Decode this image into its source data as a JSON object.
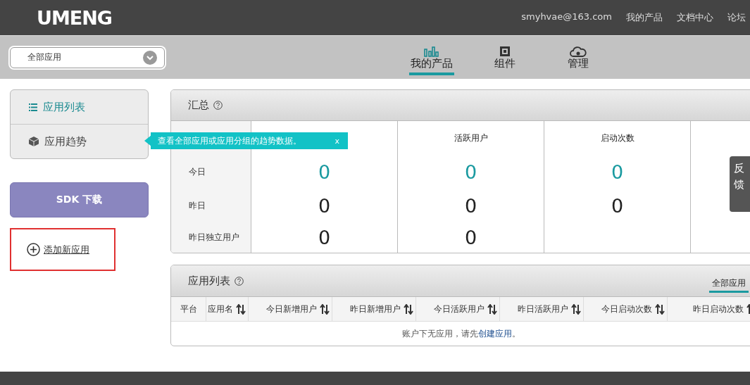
{
  "header": {
    "logo": "UMENG",
    "links": [
      "smyhvae@163.com",
      "我的产品",
      "文档中心",
      "论坛"
    ]
  },
  "subnav": {
    "app_select": "全部应用",
    "tabs": [
      {
        "label": "我的产品",
        "kind": "bars",
        "selected": true
      },
      {
        "label": "组件",
        "kind": "blocks",
        "selected": false
      },
      {
        "label": "管理",
        "kind": "cloud",
        "selected": false
      }
    ]
  },
  "sidebar": {
    "items": [
      {
        "label": "应用列表",
        "kind": "list",
        "selected": true
      },
      {
        "label": "应用趋势",
        "kind": "cube",
        "selected": false
      }
    ],
    "sdk_button": "SDK 下载",
    "add_app": "添加新应用"
  },
  "tooltip": {
    "text": "查看全部应用或应用分组的趋势数据。",
    "close": "x"
  },
  "summary": {
    "title": "汇总",
    "columns": [
      "",
      "活跃用户",
      "启动次数"
    ],
    "rows": [
      {
        "label": "今日",
        "values": [
          "0",
          "0",
          "0"
        ],
        "highlight": true
      },
      {
        "label": "昨日",
        "values": [
          "0",
          "0",
          "0"
        ],
        "highlight": false
      },
      {
        "label": "昨日独立用户",
        "values": [
          "0",
          "0"
        ],
        "highlight": false
      }
    ]
  },
  "app_list": {
    "title": "应用列表",
    "filter_tab": "全部应用",
    "columns": [
      {
        "label": "平台",
        "sortable": false
      },
      {
        "label": "应用名",
        "sortable": true
      },
      {
        "label": "今日新增用户",
        "sortable": true
      },
      {
        "label": "昨日新增用户",
        "sortable": true
      },
      {
        "label": "今日活跃用户",
        "sortable": true
      },
      {
        "label": "昨日活跃用户",
        "sortable": true
      },
      {
        "label": "今日启动次数",
        "sortable": true
      },
      {
        "label": "昨日启动次数",
        "sortable": true
      }
    ],
    "empty_before": "账户下无应用，请先",
    "empty_link": "创建应用",
    "empty_after": "。"
  },
  "feedback": "反馈"
}
